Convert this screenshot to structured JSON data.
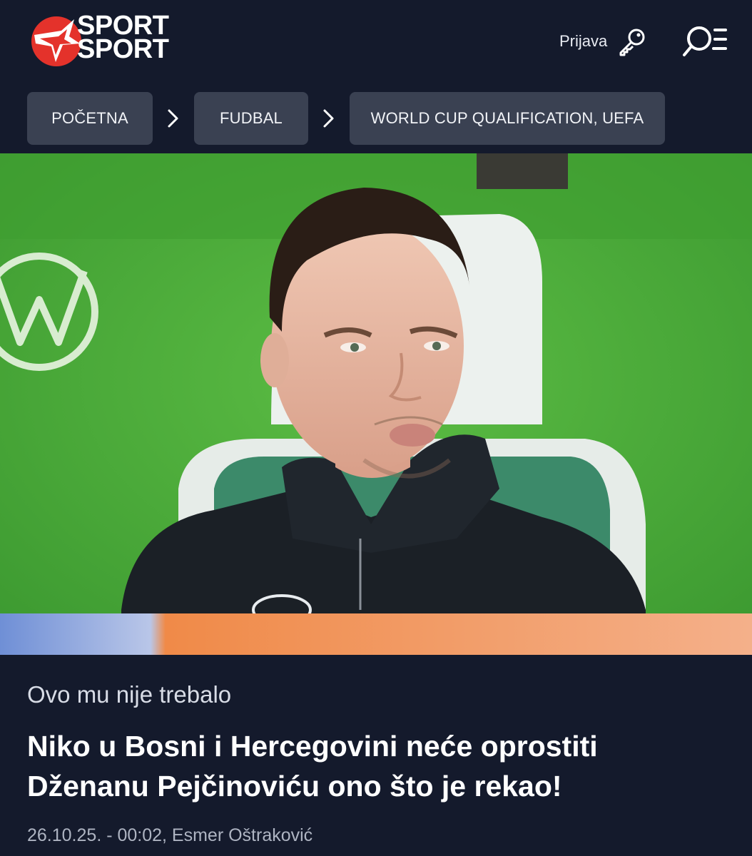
{
  "header": {
    "logo_text": [
      "SPORT",
      "SPORT"
    ],
    "logo_icon": "star-icon",
    "login_label": "Prijava",
    "login_icon": "key-icon",
    "menu_icon": "search-menu-icon"
  },
  "breadcrumbs": [
    {
      "label": "POČETNA"
    },
    {
      "label": "FUDBAL"
    },
    {
      "label": "WORLD CUP QUALIFICATION, UEFA"
    }
  ],
  "breadcrumb_separator_icon": "chevron-right-icon",
  "hero": {
    "type": "photo",
    "subject": "player-on-bench-photo"
  },
  "article": {
    "kicker": "Ovo mu nije trebalo",
    "title_line1": "Niko u Bosni i Hercegovini neće oprostiti",
    "title_line2": "Dženanu Pejčinoviću ono što je rekao!",
    "meta": "26.10.25. - 00:02, Esmer Oštraković"
  },
  "colors": {
    "background": "#141a2c",
    "breadcrumb_bg": "#3a4152",
    "logo_red": "#e4322b",
    "pitch_green": "#4fae3c"
  }
}
